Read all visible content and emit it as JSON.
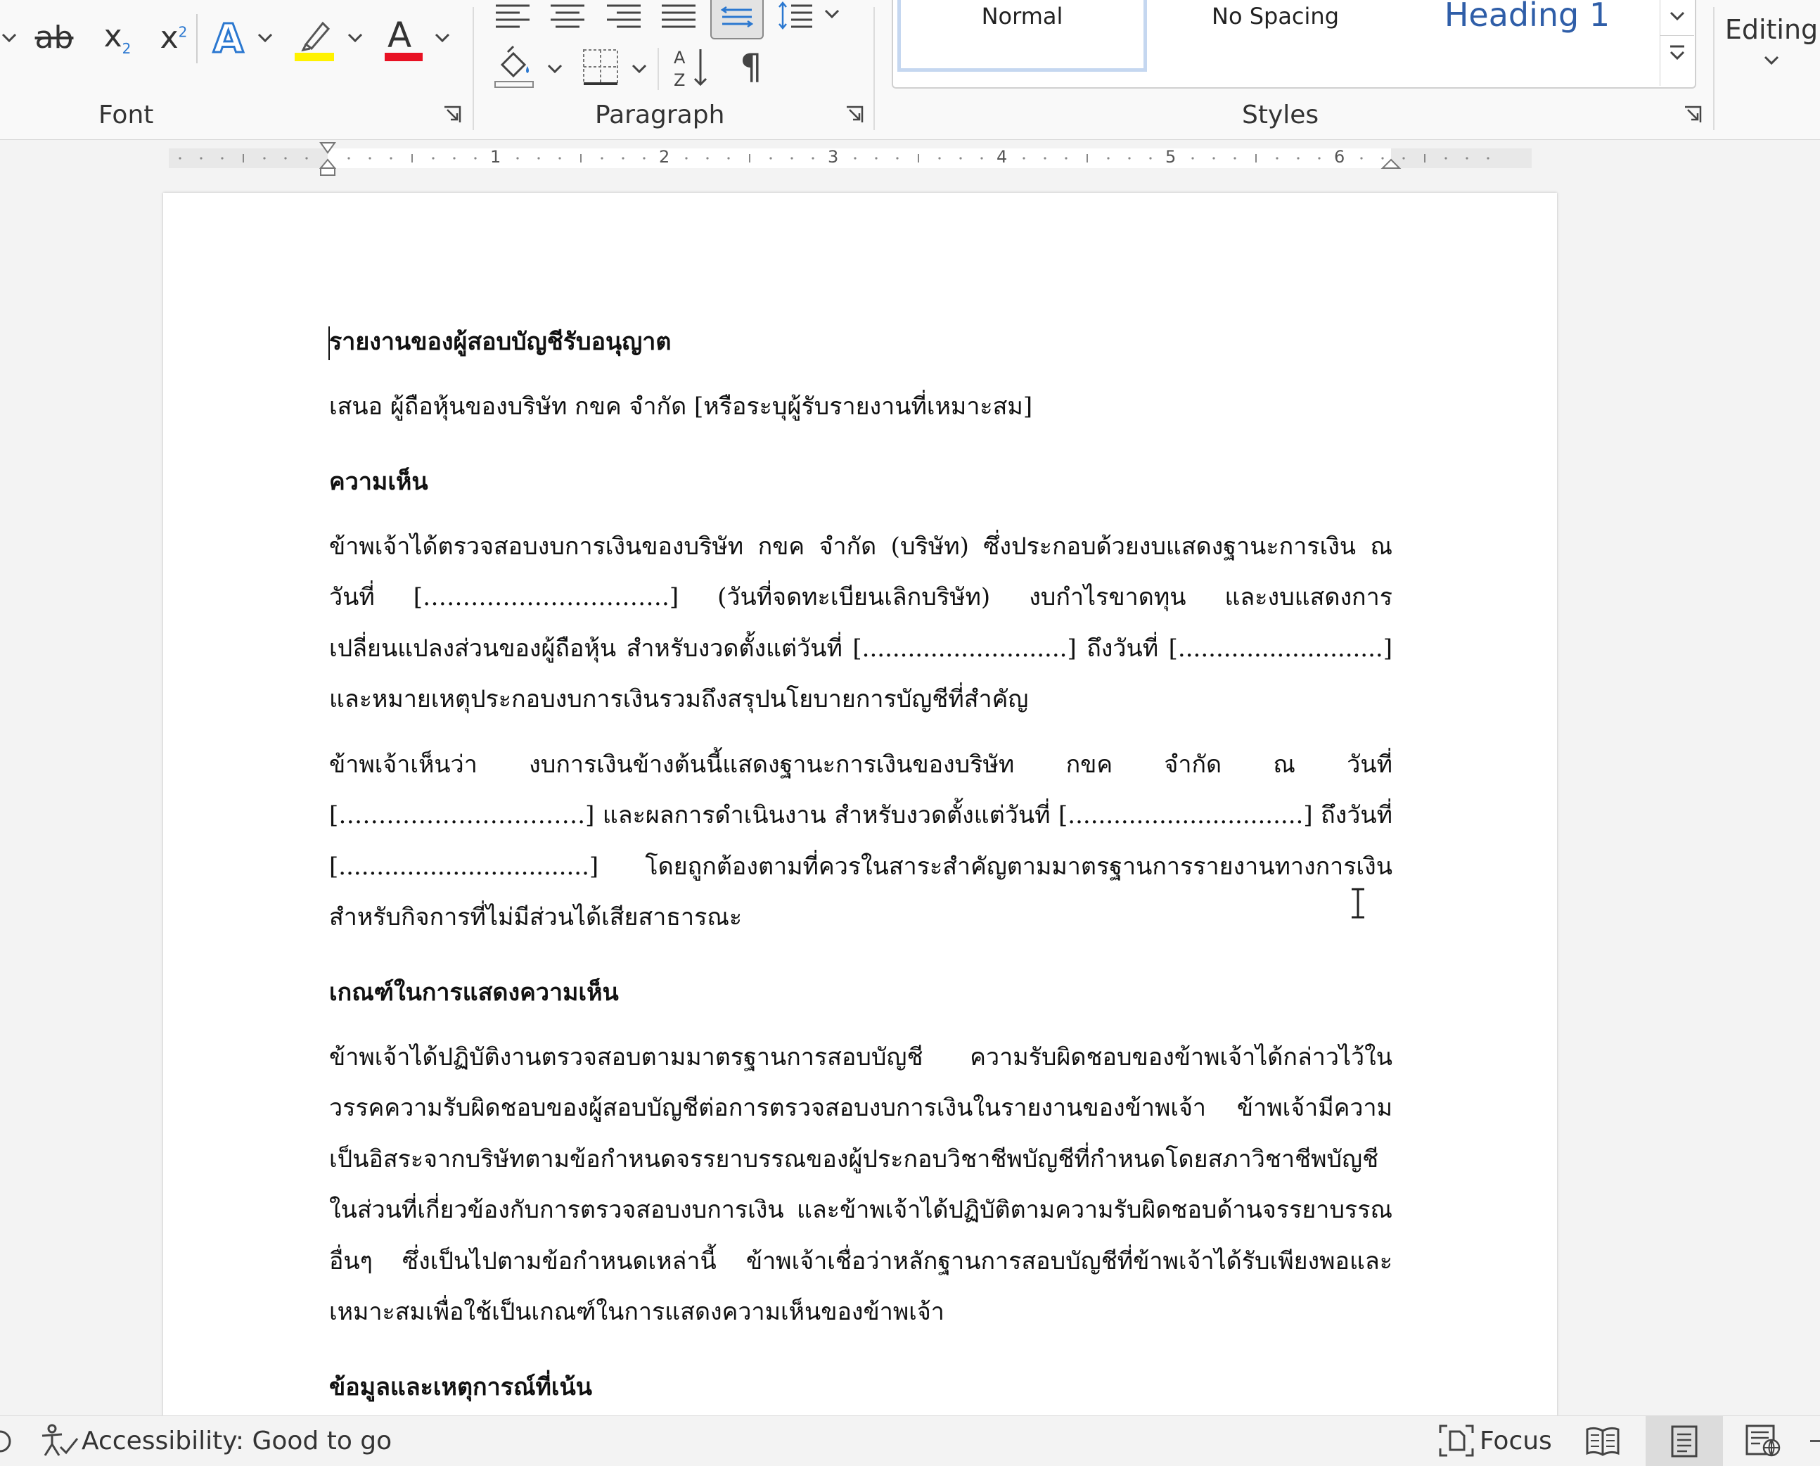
{
  "ribbon": {
    "font_group_label": "Font",
    "paragraph_group_label": "Paragraph",
    "styles_group_label": "Styles",
    "styles": [
      {
        "label": "Normal",
        "selected": true
      },
      {
        "label": "No Spacing",
        "selected": false
      },
      {
        "label": "Heading 1",
        "selected": false
      }
    ],
    "editing_label": "Editing",
    "font_color": "#e81123",
    "highlight_color": "#fff200",
    "text_effect_color": "#2b78d0"
  },
  "ruler": {
    "numbers": [
      "1",
      "2",
      "3",
      "4",
      "5",
      "6"
    ]
  },
  "document": {
    "title": "รายงานของผู้สอบบัญชีรับอนุญาต",
    "addressee": "เสนอ ผู้ถือหุ้นของบริษัท กขค จำกัด [หรือระบุผู้รับรายงานที่เหมาะสม]",
    "opinion_heading": "ความเห็น",
    "opinion_para1": "ข้าพเจ้าได้ตรวจสอบงบการเงินของบริษัท กขค จำกัด (บริษัท) ซึ่งประกอบด้วยงบแสดงฐานะการเงิน ณ วันที่ [………………………….] (วันที่จดทะเบียนเลิกบริษัท) งบกำไรขาดทุน และงบแสดงการเปลี่ยนแปลงส่วนของผู้ถือหุ้น สำหรับงวดตั้งแต่วันที่ [...........................] ถึงวันที่ [...........................] และหมายเหตุประกอบงบการเงินรวมถึงสรุปนโยบายการบัญชีที่สำคัญ",
    "opinion_para2": "ข้าพเจ้าเห็นว่า งบการเงินข้างต้นนี้แสดงฐานะการเงินของบริษัท กขค จำกัด ณ วันที่ [………………………….] และผลการดำเนินงาน สำหรับงวดตั้งแต่วันที่ [...............................] ถึงวันที่ [.................................] โดยถูกต้องตามที่ควรในสาระสำคัญตามมาตรฐานการรายงานทางการเงินสำหรับกิจการที่ไม่มีส่วนได้เสียสาธารณะ",
    "basis_heading": "เกณฑ์ในการแสดงความเห็น",
    "basis_para": "ข้าพเจ้าได้ปฏิบัติงานตรวจสอบตามมาตรฐานการสอบบัญชี ความรับผิดชอบของข้าพเจ้าได้กล่าวไว้ในวรรคความรับผิดชอบของผู้สอบบัญชีต่อการตรวจสอบงบการเงินในรายงานของข้าพเจ้า ข้าพเจ้ามีความเป็นอิสระจากบริษัทตามข้อกำหนดจรรยาบรรณของผู้ประกอบวิชาชีพบัญชีที่กำหนดโดยสภาวิชาชีพบัญชีในส่วนที่เกี่ยวข้องกับการตรวจสอบงบการเงิน และข้าพเจ้าได้ปฏิบัติตามความรับผิดชอบด้านจรรยาบรรณอื่นๆ ซึ่งเป็นไปตามข้อกำหนดเหล่านี้ ข้าพเจ้าเชื่อว่าหลักฐานการสอบบัญชีที่ข้าพเจ้าได้รับเพียงพอและเหมาะสมเพื่อใช้เป็นเกณฑ์ในการแสดงความเห็นของข้าพเจ้า",
    "emphasis_heading": "ข้อมูลและเหตุการณ์ที่เน้น"
  },
  "statusbar": {
    "accessibility": "Accessibility: Good to go",
    "focus": "Focus"
  }
}
